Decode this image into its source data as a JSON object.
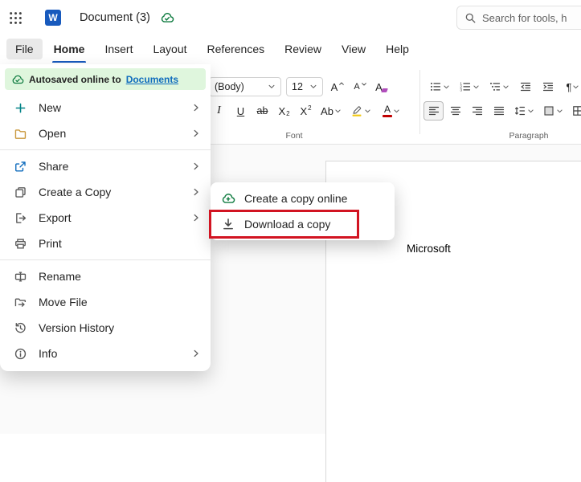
{
  "titlebar": {
    "logo_letter": "W",
    "doc_title": "Document (3)",
    "search_placeholder": "Search for tools, h"
  },
  "menubar": {
    "tabs": [
      {
        "label": "File"
      },
      {
        "label": "Home"
      },
      {
        "label": "Insert"
      },
      {
        "label": "Layout"
      },
      {
        "label": "References"
      },
      {
        "label": "Review"
      },
      {
        "label": "View"
      },
      {
        "label": "Help"
      }
    ]
  },
  "file_menu": {
    "autosave_prefix": "Autosaved online to",
    "autosave_link": "Documents",
    "items": [
      {
        "label": "New"
      },
      {
        "label": "Open"
      },
      {
        "label": "Share"
      },
      {
        "label": "Create a Copy"
      },
      {
        "label": "Export"
      },
      {
        "label": "Print"
      },
      {
        "label": "Rename"
      },
      {
        "label": "Move File"
      },
      {
        "label": "Version History"
      },
      {
        "label": "Info"
      }
    ]
  },
  "submenu": {
    "items": [
      {
        "label": "Create a copy online"
      },
      {
        "label": "Download a copy",
        "highlighted": true
      }
    ]
  },
  "ribbon": {
    "font_name": "(Body)",
    "font_size": "12",
    "font_group_label": "Font",
    "paragraph_group_label": "Paragraph",
    "glyphs": {
      "italic": "I",
      "underline": "U",
      "strikethrough": "ab",
      "sub_base": "X",
      "sub_script": "2",
      "sup_base": "X",
      "sup_script": "2",
      "effects": "Ab",
      "grow_letter": "A",
      "shrink_letter": "A",
      "clear_letter": "A",
      "color_letter": "A",
      "pilcrow": "¶"
    }
  },
  "document": {
    "body_text": "Microsoft"
  },
  "colors": {
    "accent": "#185abd",
    "autosave_green": "#107c41",
    "link": "#0f6cbd",
    "annotation_red": "#d21422",
    "font_color_swatch": "#c00000"
  }
}
